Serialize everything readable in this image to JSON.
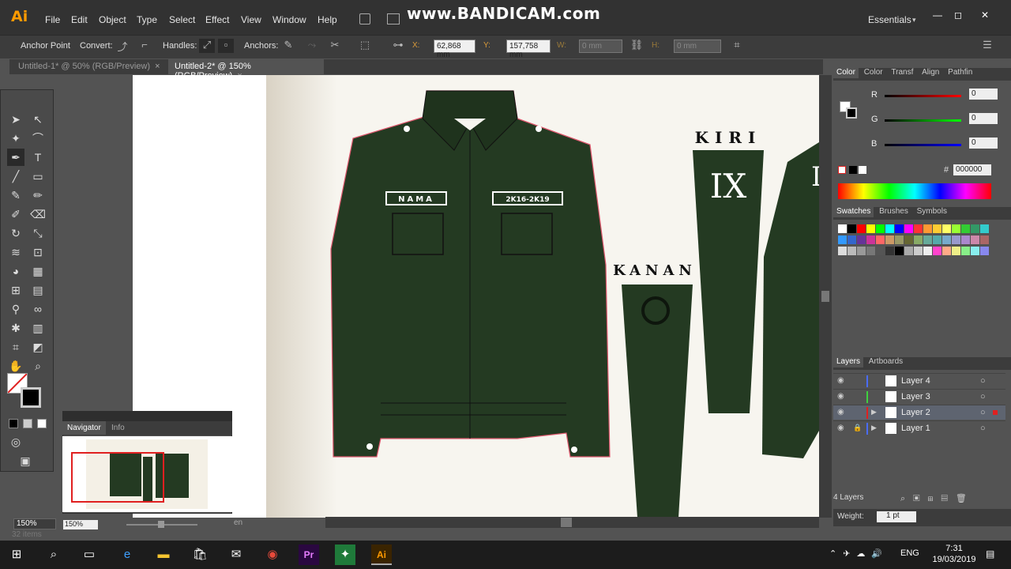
{
  "app": {
    "logo": "Ai",
    "watermark": "www.BANDICAM.com",
    "workspace": "Essentials",
    "win_min": "—",
    "win_max": "◻",
    "win_close": "✕"
  },
  "menu": [
    "File",
    "Edit",
    "Object",
    "Type",
    "Select",
    "Effect",
    "View",
    "Window",
    "Help"
  ],
  "control": {
    "anchor_point": "Anchor Point",
    "convert": "Convert:",
    "handles": "Handles:",
    "anchors": "Anchors:",
    "x_label": "X:",
    "x_value": "62,868 mm",
    "y_label": "Y:",
    "y_value": "157,758 mm",
    "w_label": "W:",
    "w_value": "0 mm",
    "h_label": "H:",
    "h_value": "0 mm"
  },
  "tabs": [
    {
      "label": "Untitled-1* @ 50% (RGB/Preview)"
    },
    {
      "label": "Untitled-2* @ 150% (RGB/Preview)"
    }
  ],
  "tab_close": "×",
  "artwork": {
    "nama": "NAMA",
    "year": "2K16-2K19",
    "kiri": "KIRI",
    "kanan": "KANAN",
    "nine": "IX",
    "partial": "I"
  },
  "navigator": {
    "tab_nav": "Navigator",
    "tab_info": "Info",
    "zoom": "150%"
  },
  "status": {
    "zoom": "150%",
    "items": "32 items",
    "toggle": "en"
  },
  "color_panel": {
    "tabs": [
      "Color",
      "Color",
      "Transf",
      "Align",
      "Pathfin"
    ],
    "r_label": "R",
    "g_label": "G",
    "b_label": "B",
    "r": "0",
    "g": "0",
    "b": "0",
    "hex_label": "#",
    "hex": "000000"
  },
  "swatch_panel": {
    "tabs": [
      "Swatches",
      "Brushes",
      "Symbols"
    ]
  },
  "layers_panel": {
    "tabs": [
      "Layers",
      "Artboards"
    ],
    "layers": [
      "Layer 4",
      "Layer 3",
      "Layer 2",
      "Layer 1"
    ],
    "count": "4 Layers",
    "weight_label": "Weight:",
    "weight": "1 pt"
  },
  "taskbar": {
    "lang": "ENG",
    "time": "7:31",
    "date": "19/03/2019"
  },
  "colors": {
    "jacket": "#243a22",
    "selection": "#e05a70",
    "accent": "#ff9a00"
  }
}
